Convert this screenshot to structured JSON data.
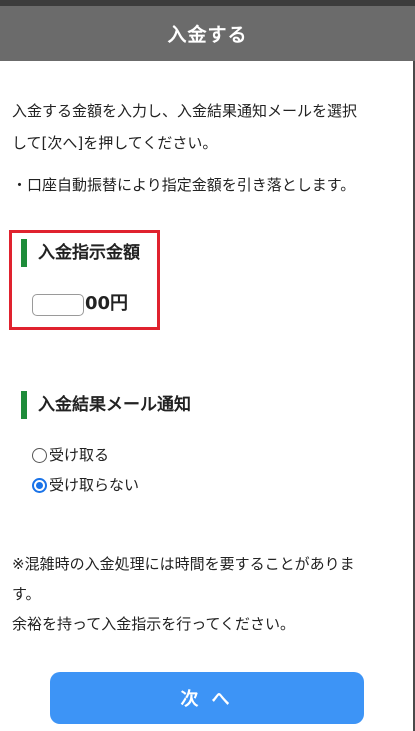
{
  "header": {
    "title": "入金する"
  },
  "intro": {
    "line1": "入金する金額を入力し、入金結果通知メールを選択",
    "line2": "して[次へ]を押してください。",
    "notice": "・口座自動振替により指定金額を引き落とします。"
  },
  "amount_section": {
    "title": "入金指示金額",
    "input_value": "",
    "suffix": "00円"
  },
  "mail_section": {
    "title": "入金結果メール通知",
    "options": [
      {
        "label": "受け取る",
        "selected": false
      },
      {
        "label": "受け取らない",
        "selected": true
      }
    ]
  },
  "caution": {
    "line1": "※混雑時の入金処理には時間を要することがありま",
    "line2": "す。",
    "line3": "余裕を持って入金指示を行ってください。"
  },
  "next_button": {
    "label": "次 へ"
  },
  "colors": {
    "header_bg": "#6b6b6b",
    "section_bar": "#1e8c3a",
    "highlight_border": "#e0222e",
    "button_bg": "#3d94f6",
    "radio_selected": "#1a73e8"
  }
}
